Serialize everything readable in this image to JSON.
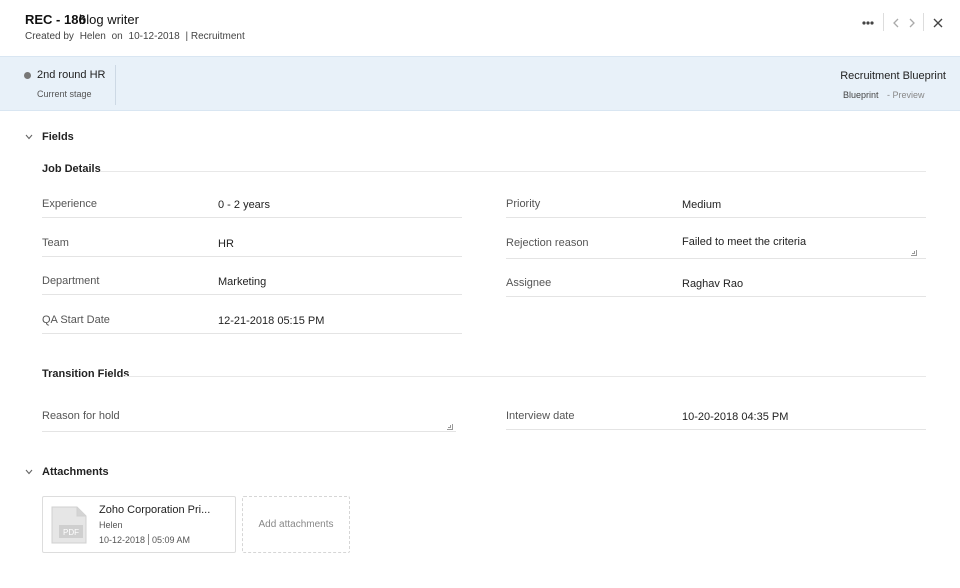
{
  "header": {
    "record_id": "REC - 186",
    "record_title": "blog writer",
    "created_by_label": "Created by",
    "created_by_user": "Helen",
    "created_on_label": "on",
    "created_on_date": "10-12-2018",
    "module": "| Recruitment",
    "more_icon": "ellipsis-icon",
    "prev_icon": "chevron-left-icon",
    "next_icon": "chevron-right-icon",
    "close_icon": "close-icon"
  },
  "stage": {
    "name": "2nd round HR",
    "caption": "Current stage",
    "blueprint_name": "Recruitment Blueprint",
    "blueprint_label": "Blueprint",
    "preview_label": "- Preview"
  },
  "fields_section": {
    "title": "Fields",
    "job_details": {
      "title": "Job Details",
      "left": [
        {
          "label": "Experience",
          "value": "0 - 2 years"
        },
        {
          "label": "Team",
          "value": "HR"
        },
        {
          "label": "Department",
          "value": "Marketing"
        },
        {
          "label": "QA Start Date",
          "value": "12-21-2018 05:15 PM"
        }
      ],
      "right": [
        {
          "label": "Priority",
          "value": "Medium"
        },
        {
          "label": "Rejection reason",
          "value": "Failed to meet the criteria"
        },
        {
          "label": "Assignee",
          "value": "Raghav Rao"
        }
      ]
    },
    "transition_fields": {
      "title": "Transition Fields",
      "reason_for_hold_label": "Reason for hold",
      "reason_for_hold_value": "",
      "interview_date_label": "Interview date",
      "interview_date_value": "10-20-2018 04:35 PM"
    }
  },
  "attachments": {
    "title": "Attachments",
    "items": [
      {
        "name": "Zoho Corporation Pri...",
        "owner": "Helen",
        "date": "10-12-2018",
        "time": "05:09 AM",
        "type": "PDF"
      }
    ],
    "add_label": "Add attachments"
  },
  "colors": {
    "stage_bar_bg": "#e8f1f9",
    "stage_dot": "#777777"
  }
}
